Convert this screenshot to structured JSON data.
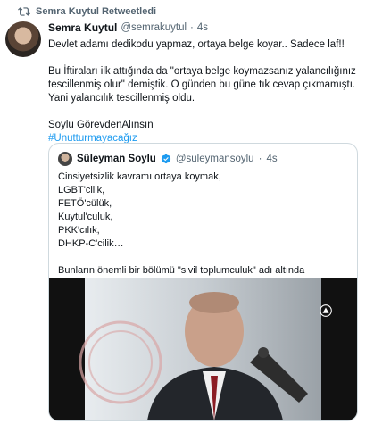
{
  "retweet": {
    "label": "Semra Kuytul Retweetledi"
  },
  "tweet": {
    "name": "Semra Kuytul",
    "handle": "@semrakuytul",
    "separator": "·",
    "time": "4s",
    "paragraphs": [
      "Devlet adamı dedikodu yapmaz, ortaya belge koyar.. Sadece laf!!",
      "Bu İftiraları ilk attığında da \"ortaya belge koymazsanız yalancılığınız tescillenmiş olur\" demiştik. O günden bu güne tık cevap çıkmamıştı. Yani yalancılık tescillenmiş oldu.",
      "Soylu GörevdenAlınsın"
    ],
    "hashtag": "#Unutturmayacağız"
  },
  "quote": {
    "name": "Süleyman Soylu",
    "handle": "@suleymansoylu",
    "separator": "·",
    "time": "4s",
    "lines": [
      "Cinsiyetsizlik kavramı ortaya koymak,",
      "LGBT'cilik,",
      "FETÖ'cülük,",
      "Kuytul'culuk,",
      "PKK'cılık,",
      "DHKP-C'cilik…"
    ],
    "paragraph": "Bunların önemli bir bölümü \"sivil toplumculuk\" adı altında geliştirilmektedir ve bunların her birinin kökü dışardadır…"
  },
  "colors": {
    "accent": "#1d9bf0",
    "muted": "#536471",
    "border": "#cfd9de"
  },
  "icons": {
    "retweet": "retweet-icon",
    "verified": "verified-badge-icon",
    "video_logo": "news-agency-logo-icon"
  }
}
